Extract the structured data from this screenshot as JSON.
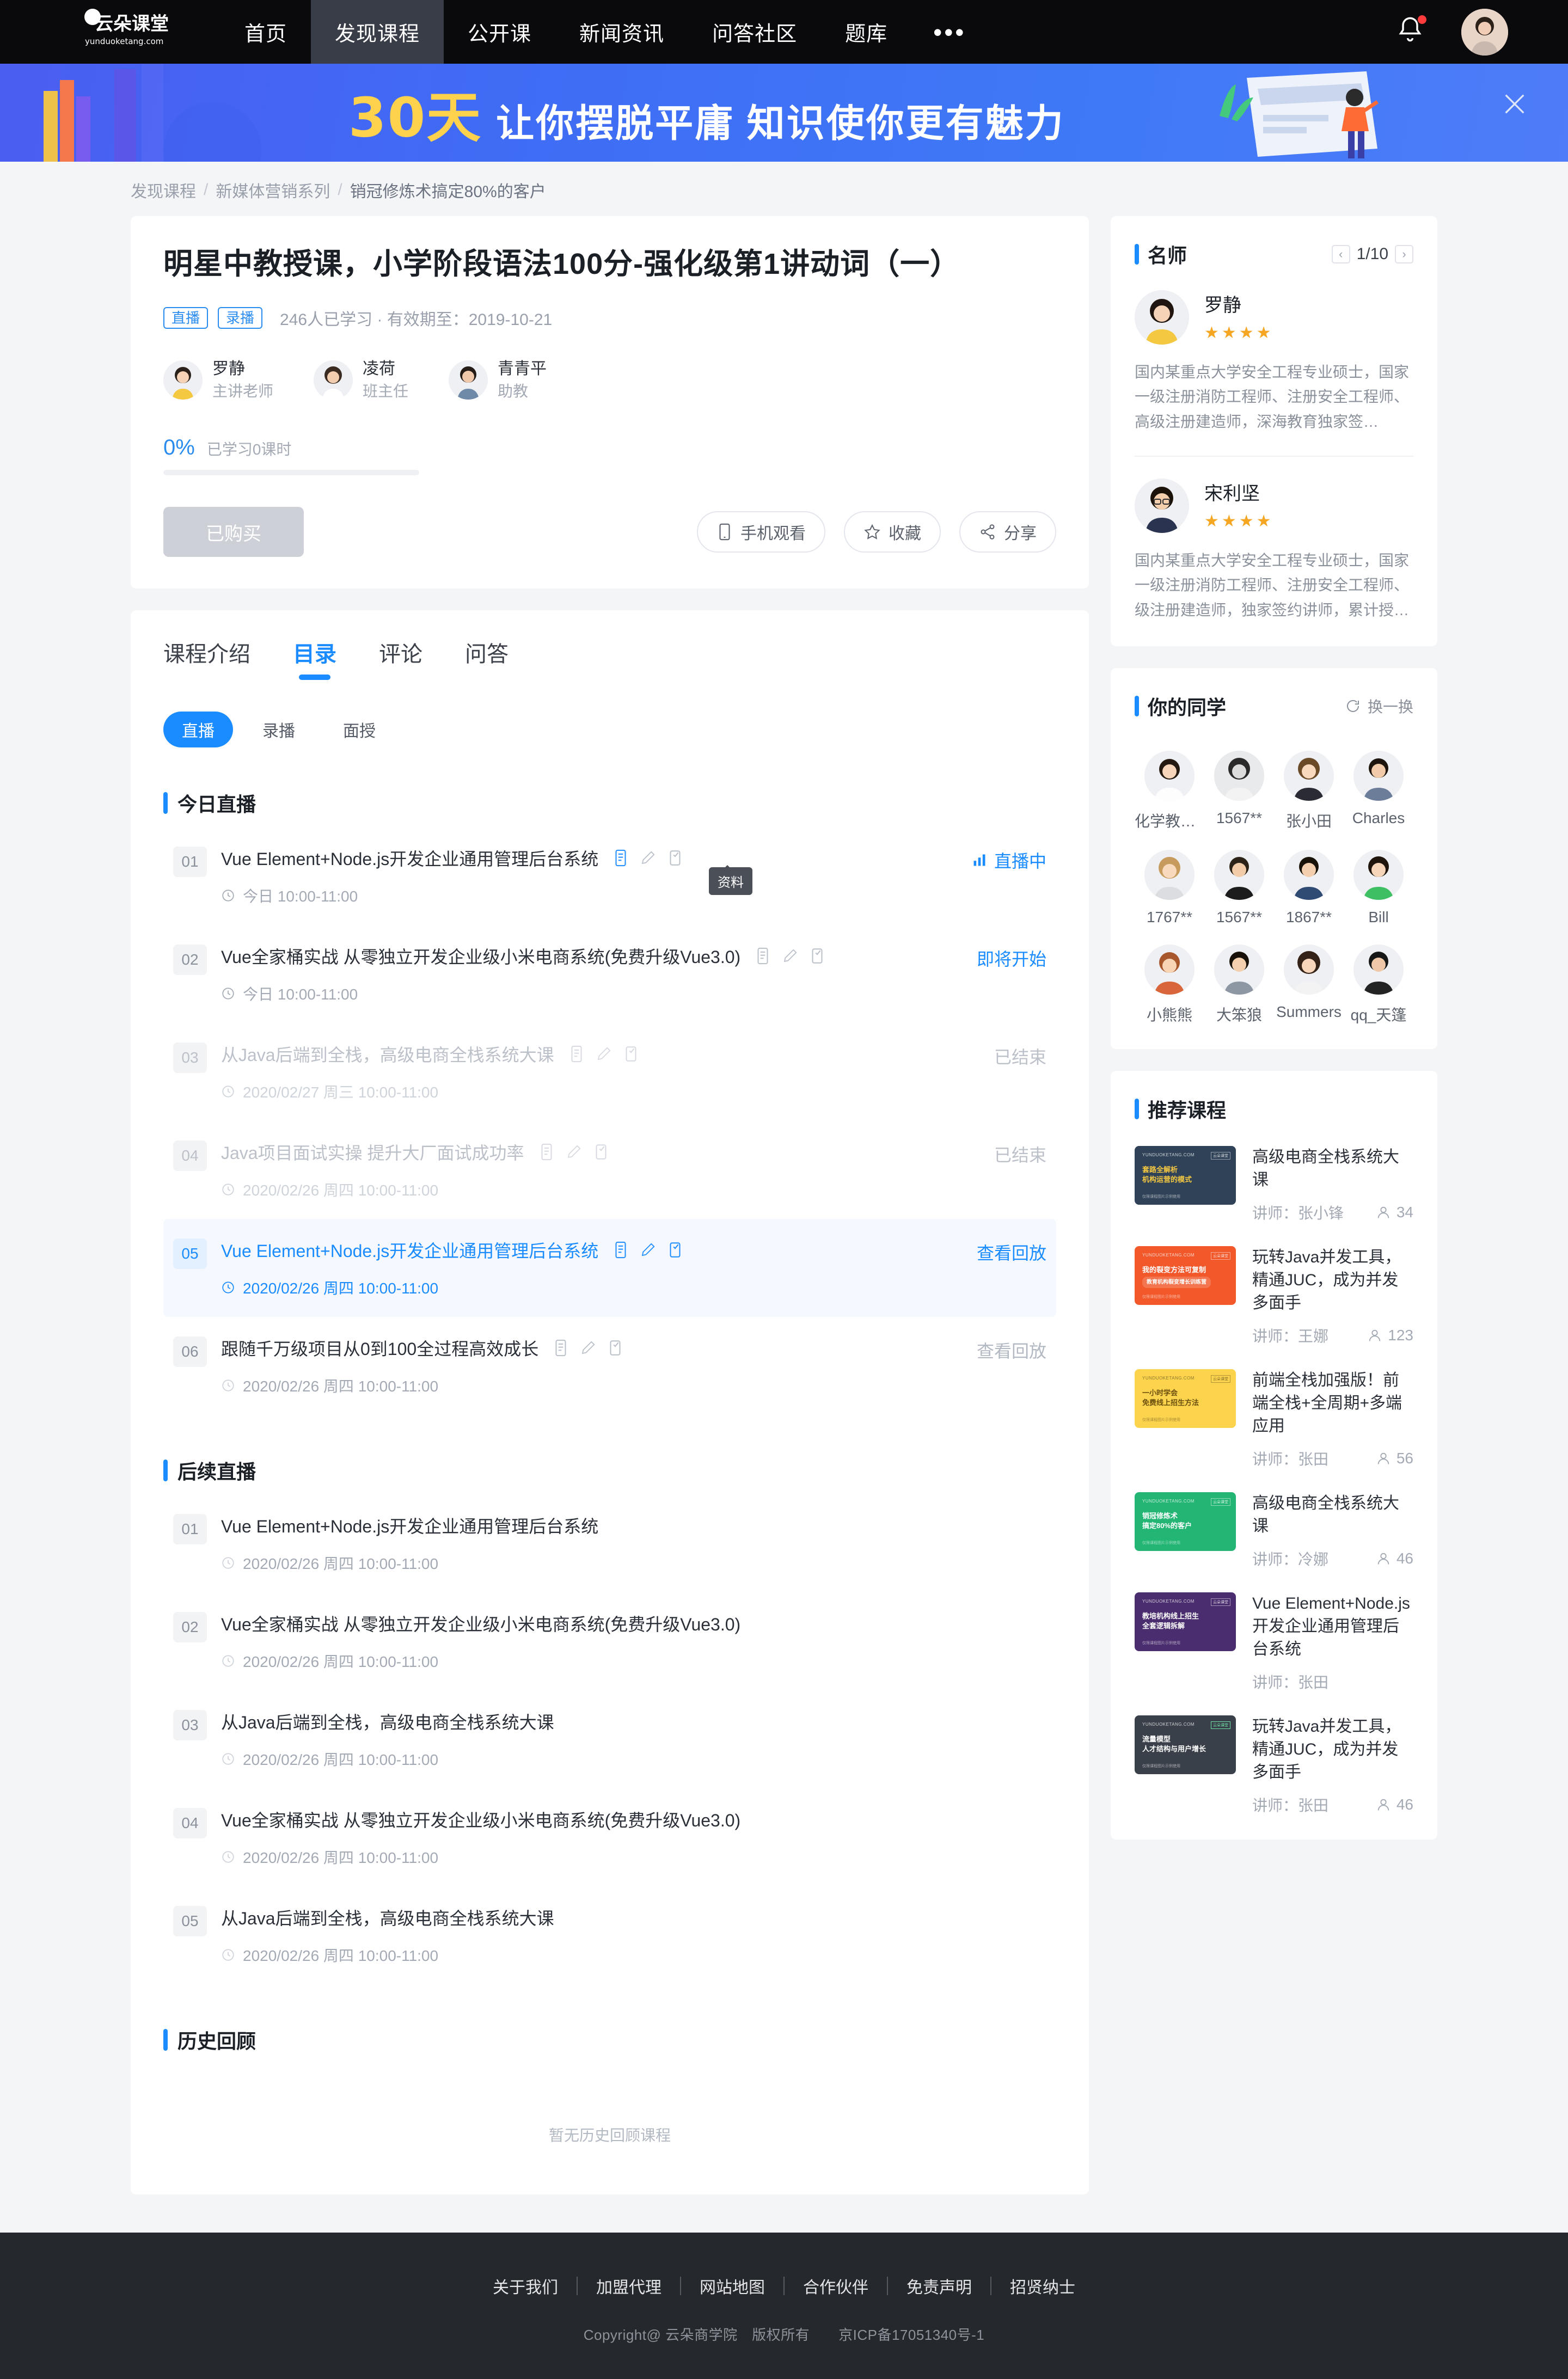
{
  "nav": {
    "logo_text": "云朵课堂",
    "logo_sub": "yunduoketang.com",
    "links": [
      {
        "label": "首页",
        "active": false
      },
      {
        "label": "发现课程",
        "active": true
      },
      {
        "label": "公开课",
        "active": false
      },
      {
        "label": "新闻资讯",
        "active": false
      },
      {
        "label": "问答社区",
        "active": false
      },
      {
        "label": "题库",
        "active": false
      }
    ],
    "more": "•••"
  },
  "banner": {
    "highlight": "30天",
    "text": "让你摆脱平庸 知识使你更有魅力"
  },
  "breadcrumb": {
    "items": [
      "发现课程",
      "新媒体营销系列",
      "销冠修炼术搞定80%的客户"
    ],
    "separator": "/"
  },
  "hero": {
    "title": "明星中教授课，小学阶段语法100分-强化级第1讲动词（一）",
    "tags": [
      "直播",
      "录播"
    ],
    "meta": "246人已学习 · 有效期至：2019-10-21",
    "teachers": [
      {
        "name": "罗静",
        "role": "主讲老师"
      },
      {
        "name": "凌荷",
        "role": "班主任"
      },
      {
        "name": "青青平",
        "role": "助教"
      }
    ],
    "progress_pct": "0%",
    "progress_label": "已学习0课时",
    "progress_value": 0,
    "buy_button": "已购买",
    "actions": [
      {
        "label": "手机观看",
        "icon": "mobile-icon"
      },
      {
        "label": "收藏",
        "icon": "star-icon"
      },
      {
        "label": "分享",
        "icon": "share-icon"
      }
    ]
  },
  "tabs": [
    {
      "label": "课程介绍",
      "active": false
    },
    {
      "label": "目录",
      "active": true
    },
    {
      "label": "评论",
      "active": false
    },
    {
      "label": "问答",
      "active": false
    }
  ],
  "chips": [
    {
      "label": "直播",
      "active": true
    },
    {
      "label": "录播",
      "active": false
    },
    {
      "label": "面授",
      "active": false
    }
  ],
  "tooltip": "资料",
  "sections": [
    {
      "title": "今日直播",
      "lessons": [
        {
          "num": "01",
          "title": "Vue Element+Node.js开发企业通用管理后台系统",
          "time": "今日 10:00-11:00",
          "state": "直播中",
          "state_style": "live",
          "icons": true,
          "style": "normal"
        },
        {
          "num": "02",
          "title": "Vue全家桶实战 从零独立开发企业级小米电商系统(免费升级Vue3.0)",
          "time": "今日 10:00-11:00",
          "state": "即将开始",
          "state_style": "blue",
          "icons": true,
          "style": "normal"
        },
        {
          "num": "03",
          "title": "从Java后端到全栈，高级电商全栈系统大课",
          "time": "2020/02/27 周三 10:00-11:00",
          "state": "已结束",
          "state_style": "gray",
          "icons": true,
          "style": "done"
        },
        {
          "num": "04",
          "title": "Java项目面试实操 提升大厂面试成功率",
          "time": "2020/02/26 周四 10:00-11:00",
          "state": "已结束",
          "state_style": "gray",
          "icons": true,
          "style": "done"
        },
        {
          "num": "05",
          "title": "Vue Element+Node.js开发企业通用管理后台系统",
          "time": "2020/02/26 周四 10:00-11:00",
          "state": "查看回放",
          "state_style": "blue",
          "icons": true,
          "style": "hl"
        },
        {
          "num": "06",
          "title": "跟随千万级项目从0到100全过程高效成长",
          "time": "2020/02/26 周四 10:00-11:00",
          "state": "查看回放",
          "state_style": "muted",
          "icons": true,
          "style": "normal"
        }
      ]
    },
    {
      "title": "后续直播",
      "lessons": [
        {
          "num": "01",
          "title": "Vue Element+Node.js开发企业通用管理后台系统",
          "time": "2020/02/26 周四 10:00-11:00",
          "state": "",
          "state_style": "",
          "icons": false,
          "style": "normal"
        },
        {
          "num": "02",
          "title": "Vue全家桶实战 从零独立开发企业级小米电商系统(免费升级Vue3.0)",
          "time": "2020/02/26 周四 10:00-11:00",
          "state": "",
          "state_style": "",
          "icons": false,
          "style": "normal"
        },
        {
          "num": "03",
          "title": "从Java后端到全栈，高级电商全栈系统大课",
          "time": "2020/02/26 周四 10:00-11:00",
          "state": "",
          "state_style": "",
          "icons": false,
          "style": "normal"
        },
        {
          "num": "04",
          "title": "Vue全家桶实战 从零独立开发企业级小米电商系统(免费升级Vue3.0)",
          "time": "2020/02/26 周四 10:00-11:00",
          "state": "",
          "state_style": "",
          "icons": false,
          "style": "normal"
        },
        {
          "num": "05",
          "title": "从Java后端到全栈，高级电商全栈系统大课",
          "time": "2020/02/26 周四 10:00-11:00",
          "state": "",
          "state_style": "",
          "icons": false,
          "style": "normal"
        }
      ]
    }
  ],
  "history": {
    "title": "历史回顾",
    "empty": "暂无历史回顾课程"
  },
  "sidebar": {
    "famous": {
      "title": "名师",
      "page": "1/10",
      "prev": "‹",
      "next": "›",
      "teachers": [
        {
          "name": "罗静",
          "stars": 4,
          "desc": "国内某重点大学安全工程专业硕士，国家一级注册消防工程师、注册安全工程师、高级注册建造师，深海教育独家签…"
        },
        {
          "name": "宋利坚",
          "stars": 4,
          "desc": "国内某重点大学安全工程专业硕士，国家一级注册消防工程师、注册安全工程师、级注册建造师，独家签约讲师，累计授…"
        }
      ]
    },
    "classmates": {
      "title": "你的同学",
      "swap": "换一换",
      "items": [
        {
          "name": "化学教书…"
        },
        {
          "name": "1567**"
        },
        {
          "name": "张小田"
        },
        {
          "name": "Charles"
        },
        {
          "name": "1767**"
        },
        {
          "name": "1567**"
        },
        {
          "name": "1867**"
        },
        {
          "name": "Bill"
        },
        {
          "name": "小熊熊"
        },
        {
          "name": "大笨狼"
        },
        {
          "name": "Summers"
        },
        {
          "name": "qq_天篷"
        }
      ]
    },
    "recommend": {
      "title": "推荐课程",
      "teacher_prefix": "讲师：",
      "items": [
        {
          "title": "高级电商全栈系统大课",
          "teacher": "张小锋",
          "count": "34",
          "thumb_color": "#2f4257",
          "thumb_line1": "套路全解析",
          "thumb_line2": "机构运营的模式",
          "thumb_accent": "#f5c842"
        },
        {
          "title": "玩转Java并发工具，精通JUC，成为并发多面手",
          "teacher": "王娜",
          "count": "123",
          "thumb_color": "#f2582a",
          "thumb_line1": "我的裂变方法可复制",
          "thumb_line2": "教育机构裂变增长训练营",
          "thumb_accent": "#ffffff"
        },
        {
          "title": "前端全栈加强版！前端全栈+全周期+多端应用",
          "teacher": "张田",
          "count": "56",
          "thumb_color": "#fcd34d",
          "thumb_line1": "一小时学会",
          "thumb_line2": "免费线上招生方法",
          "thumb_accent": "#7a5c12"
        },
        {
          "title": "高级电商全栈系统大课",
          "teacher": "冷娜",
          "count": "46",
          "thumb_color": "#22b573",
          "thumb_line1": "销冠修炼术",
          "thumb_line2": "搞定80%的客户",
          "thumb_accent": "#ffffff"
        },
        {
          "title": "Vue Element+Node.js开发企业通用管理后台系统",
          "teacher": "张田",
          "count": "",
          "thumb_color": "#4a2d6e",
          "thumb_line1": "教培机构线上招生",
          "thumb_line2": "全套逻辑拆解",
          "thumb_accent": "#ffffff"
        },
        {
          "title": "玩转Java并发工具，精通JUC，成为并发多面手",
          "teacher": "张田",
          "count": "46",
          "thumb_color": "#3a4049",
          "thumb_line1": "流量模型",
          "thumb_line2": "人才结构与用户增长",
          "thumb_accent": "#ffffff"
        }
      ]
    }
  },
  "footer": {
    "links": [
      "关于我们",
      "加盟代理",
      "网站地图",
      "合作伙伴",
      "免责声明",
      "招贤纳士"
    ],
    "copyright": "Copyright@ 云朵商学院　版权所有　　京ICP备17051340号-1"
  }
}
